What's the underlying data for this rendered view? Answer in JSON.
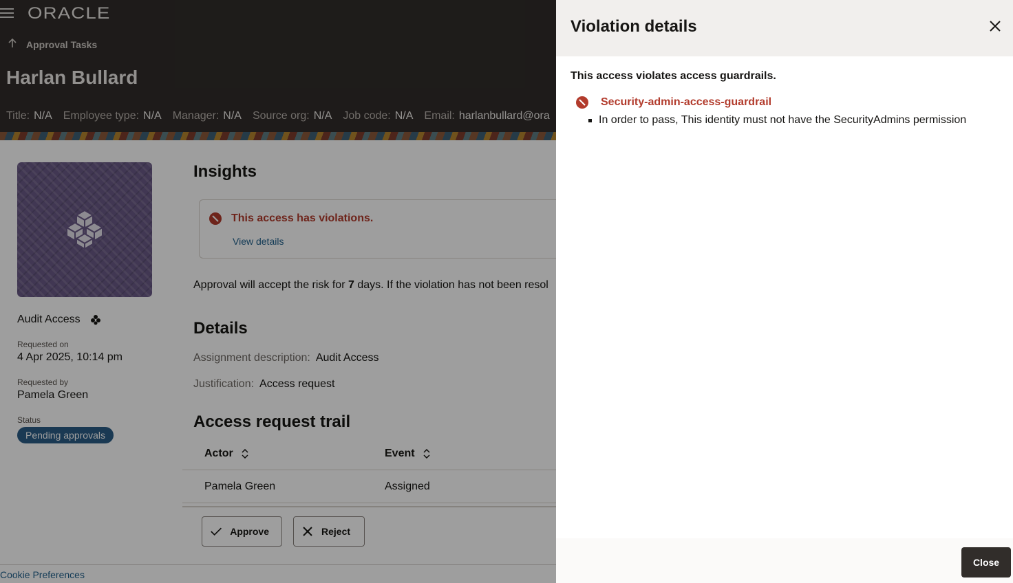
{
  "header": {
    "logo": "ORACLE",
    "back_label": "Approval Tasks",
    "person_name": "Harlan Bullard",
    "meta": [
      {
        "key": "Title:",
        "value": "N/A"
      },
      {
        "key": "Employee type:",
        "value": "N/A"
      },
      {
        "key": "Manager:",
        "value": "N/A"
      },
      {
        "key": "Source org:",
        "value": "N/A"
      },
      {
        "key": "Job code:",
        "value": "N/A"
      },
      {
        "key": "Email:",
        "value": "harlanbullard@ora"
      }
    ]
  },
  "left": {
    "item_name": "Audit Access",
    "requested_on_label": "Requested on",
    "requested_on": "4 Apr 2025, 10:14 pm",
    "requested_by_label": "Requested by",
    "requested_by": "Pamela Green",
    "status_label": "Status",
    "status": "Pending approvals"
  },
  "insights": {
    "title": "Insights",
    "alert_text": "This access has violations.",
    "alert_link": "View details",
    "risk_prefix": "Approval will accept the risk for ",
    "risk_days": "7",
    "risk_suffix": " days. If the violation has not been resol"
  },
  "details": {
    "title": "Details",
    "assignment_label": "Assignment description:",
    "assignment_value": "Audit Access",
    "justification_label": "Justification:",
    "justification_value": "Access request"
  },
  "trail": {
    "title": "Access request trail",
    "columns": [
      "Actor",
      "Event"
    ],
    "rows": [
      [
        "Pamela Green",
        "Assigned"
      ]
    ]
  },
  "actions": {
    "approve": "Approve",
    "reject": "Reject"
  },
  "footer": {
    "cookie": "Cookie Preferences"
  },
  "drawer": {
    "title": "Violation details",
    "lead": "This access violates access guardrails.",
    "violation_name": "Security-admin-access-guardrail",
    "violation_detail": "In order to pass, This identity must not have the SecurityAdmins permission",
    "close_label": "Close"
  },
  "colors": {
    "error": "#b23b2c",
    "header_bg": "#312d2a",
    "status_badge": "#2b5d86",
    "link": "#1f5f8b"
  }
}
